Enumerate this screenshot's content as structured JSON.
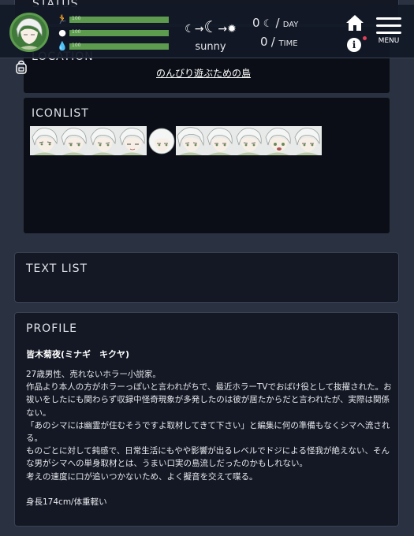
{
  "status": {
    "title": "STATUS",
    "bars": [
      {
        "icon": "running-person-icon",
        "value": "100"
      },
      {
        "icon": "apple-icon",
        "value": "100"
      },
      {
        "icon": "water-drop-icon",
        "value": "100"
      }
    ],
    "weather_label": "sunny",
    "day_count": "0",
    "day_unit": "DAY",
    "time_count": "0",
    "time_unit": "TIME",
    "menu_label": "MENU"
  },
  "location": {
    "title": "LOCATION",
    "place": "のんびり遊ぶための島"
  },
  "iconlist": {
    "title": "ICONLIST",
    "count": 10
  },
  "textlist": {
    "title": "TEXT LIST"
  },
  "profile": {
    "title": "PROFILE",
    "name": "皆木菊夜(ミナギ　キクヤ)",
    "lines": [
      "27歳男性、売れないホラー小説家。",
      "作品より本人の方がホラーっぽいと言われがちで、最近ホラーTVでおばけ役として抜擢された。お祓いをしたにも関わらず収録中怪奇現象が多発したのは彼が居たからだと言われたが、実際は関係ない。",
      "「あのシマには幽霊が住むそうですよ取材してきて下さい」と編集に何の準備もなくシマへ流される。",
      "ものごとに対して鈍感で、日常生活にもやや影響が出るレベルでドジによる怪我が絶えない、そんな男がシマへの単身取材とは、うまい口実の島流しだったのかもしれない。",
      "考えの速度に口が追いつかないため、よく擬音を交えて喋る。"
    ],
    "stats": "身長174cm/体重軽い"
  },
  "colors": {
    "accent_green": "#5d9c4e",
    "panel_bg": "#141824",
    "inner_bg": "#07090f",
    "page_bg": "#2a3140"
  }
}
